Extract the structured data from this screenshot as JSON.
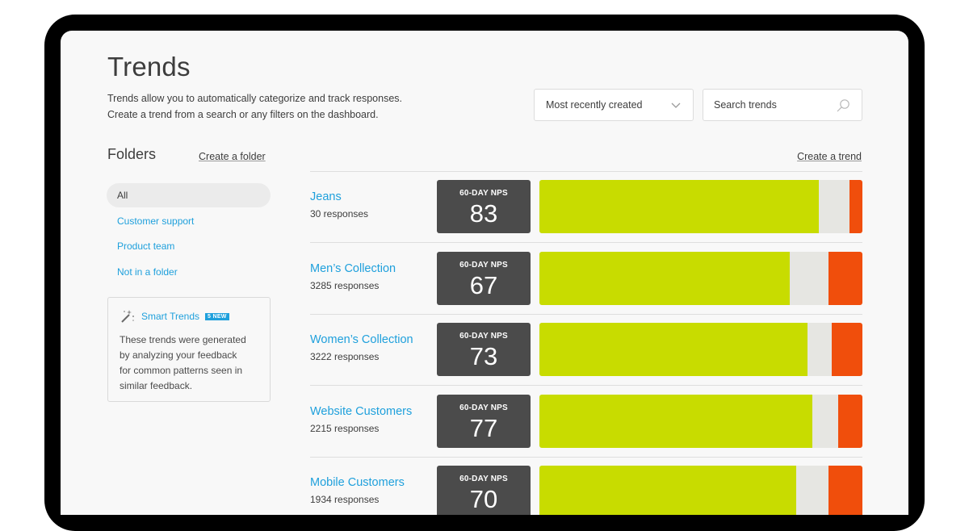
{
  "page": {
    "title": "Trends",
    "intro_line1": "Trends allow you to automatically categorize and track responses.",
    "intro_line2": "Create a trend from a search or any filters on the dashboard."
  },
  "controls": {
    "sort_value": "Most recently created",
    "search_placeholder": "Search trends"
  },
  "folders": {
    "title": "Folders",
    "create_label": "Create a folder",
    "items": [
      {
        "label": "All"
      },
      {
        "label": "Customer support"
      },
      {
        "label": "Product team"
      },
      {
        "label": "Not in a folder"
      }
    ]
  },
  "smart_trends": {
    "label": "Smart Trends",
    "badge": "5 NEW",
    "text_line1": "These trends were generated",
    "text_line2": "by analyzing your feedback",
    "text_line3": "for common patterns seen in",
    "text_line4": "similar feedback."
  },
  "create_trend_label": "Create a trend",
  "colors": {
    "promoters": "#c8dc00",
    "passives": "#e6e6e2",
    "detractors": "#f04e0c",
    "link": "#1fa0dc",
    "nps_box": "#4b4b4b"
  },
  "trends": [
    {
      "name": "Jeans",
      "responses": "30 responses",
      "nps_label": "60-DAY NPS",
      "nps": "83",
      "promoters_pct": 86.5,
      "passives_pct": 9.5,
      "detractors_pct": 4
    },
    {
      "name": "Men’s Collection",
      "responses": "3285 responses",
      "nps_label": "60-DAY NPS",
      "nps": "67",
      "promoters_pct": 77.5,
      "passives_pct": 12,
      "detractors_pct": 10.5
    },
    {
      "name": "Women’s Collection",
      "responses": "3222 responses",
      "nps_label": "60-DAY NPS",
      "nps": "73",
      "promoters_pct": 83,
      "passives_pct": 7.5,
      "detractors_pct": 9.5
    },
    {
      "name": "Website Customers",
      "responses": "2215 responses",
      "nps_label": "60-DAY NPS",
      "nps": "77",
      "promoters_pct": 84.5,
      "passives_pct": 8,
      "detractors_pct": 7.5
    },
    {
      "name": "Mobile Customers",
      "responses": "1934 responses",
      "nps_label": "60-DAY NPS",
      "nps": "70",
      "promoters_pct": 79.5,
      "passives_pct": 10,
      "detractors_pct": 10.5
    }
  ]
}
